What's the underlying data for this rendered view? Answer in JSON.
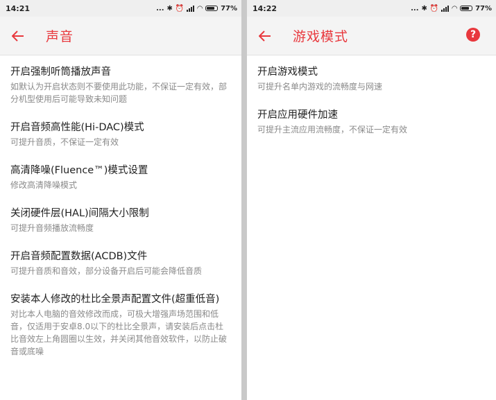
{
  "left": {
    "status": {
      "time": "14:21",
      "more": "...",
      "battery": "77%"
    },
    "appbar": {
      "title": "声音"
    },
    "items": [
      {
        "title": "开启强制听筒播放声音",
        "desc": "如默认为开启状态则不要使用此功能，不保证一定有效，部分机型使用后可能导致未知问题"
      },
      {
        "title": "开启音频高性能(Hi-DAC)模式",
        "desc": "可提升音质，不保证一定有效"
      },
      {
        "title": "高清降噪(Fluence™)模式设置",
        "desc": "修改高清降噪模式"
      },
      {
        "title": "关闭硬件层(HAL)间隔大小限制",
        "desc": "可提升音频播放流畅度"
      },
      {
        "title": "开启音频配置数据(ACDB)文件",
        "desc": "可提升音质和音效，部分设备开启后可能会降低音质"
      },
      {
        "title": "安装本人修改的杜比全景声配置文件(超重低音)",
        "desc": "对比本人电脑的音效修改而成，可极大增强声场范围和低音，仅适用于安卓8.0以下的杜比全景声，请安装后点击杜比音效左上角圆圈以生效，并关闭其他音效软件，以防止破音或底噪"
      }
    ]
  },
  "right": {
    "status": {
      "time": "14:22",
      "more": "...",
      "battery": "77%"
    },
    "appbar": {
      "title": "游戏模式",
      "help_glyph": "?"
    },
    "items": [
      {
        "title": "开启游戏模式",
        "desc": "可提升名单内游戏的流畅度与网速"
      },
      {
        "title": "开启应用硬件加速",
        "desc": "可提升主流应用流畅度，不保证一定有效"
      }
    ]
  },
  "colors": {
    "accent": "#e8383d",
    "text": "#1f1f1f",
    "secondary": "#8a8a8a",
    "appbar_bg": "#f4f4f4",
    "statusbar_bg": "#efefef"
  }
}
